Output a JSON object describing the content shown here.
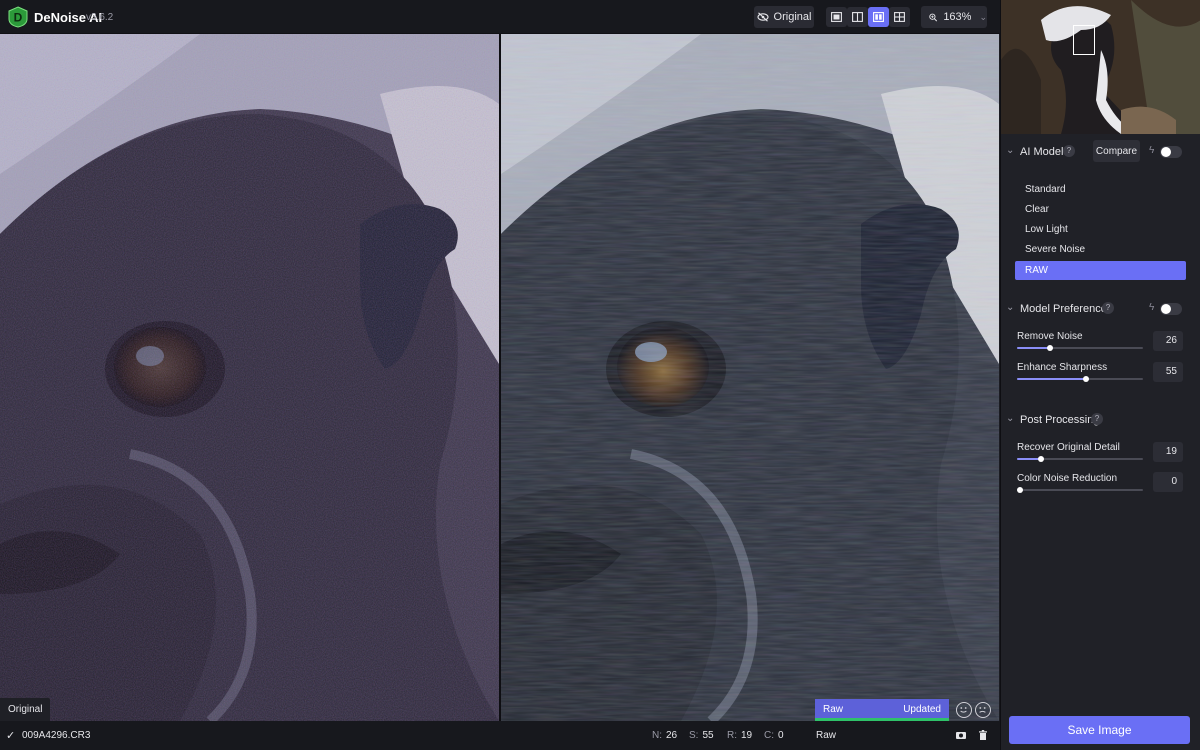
{
  "app": {
    "name": "DeNoise AI",
    "version": "v3.6.2"
  },
  "toolbar": {
    "original_label": "Original",
    "zoom_label": "163%",
    "view_modes": [
      "single-view",
      "split-view",
      "side-by-side-view",
      "comparison-view"
    ],
    "active_view": "side-by-side-view"
  },
  "preview": {
    "left_label": "Original",
    "status_model": "Raw",
    "status_state": "Updated"
  },
  "bottom": {
    "filename": "009A4296.CR3",
    "stats": [
      {
        "key": "N:",
        "value": "26"
      },
      {
        "key": "S:",
        "value": "55"
      },
      {
        "key": "R:",
        "value": "19"
      },
      {
        "key": "C:",
        "value": "0"
      }
    ],
    "model": "Raw"
  },
  "sidebar": {
    "ai_model": {
      "title": "AI Model",
      "help": "?",
      "compare_label": "Compare",
      "items": [
        "Standard",
        "Clear",
        "Low Light",
        "Severe Noise",
        "RAW"
      ],
      "selected": "RAW"
    },
    "model_preferences": {
      "title": "Model Preferences",
      "help": "?",
      "sliders": [
        {
          "label": "Remove Noise",
          "value": "26"
        },
        {
          "label": "Enhance Sharpness",
          "value": "55"
        }
      ]
    },
    "post_processing": {
      "title": "Post Processing",
      "help": "?",
      "sliders": [
        {
          "label": "Recover Original Detail",
          "value": "19"
        },
        {
          "label": "Color Noise Reduction",
          "value": "0"
        }
      ]
    },
    "save_label": "Save Image"
  },
  "colors": {
    "accent": "#6a6ff5",
    "success": "#2fc26a",
    "panel": "#202127",
    "bar": "#17181d"
  }
}
